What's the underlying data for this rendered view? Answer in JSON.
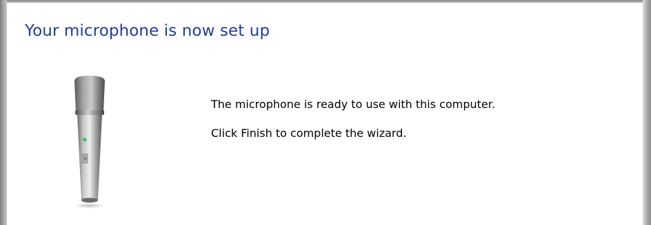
{
  "wizard": {
    "title": "Your microphone is now set up",
    "messages": {
      "ready": "The microphone is ready to use with this computer.",
      "finish": "Click Finish to complete the wizard."
    },
    "illustration": {
      "icon": "microphone-icon",
      "led_color": "#29c94a"
    },
    "colors": {
      "title": "#1e3d9a",
      "body_text": "#000000"
    }
  }
}
